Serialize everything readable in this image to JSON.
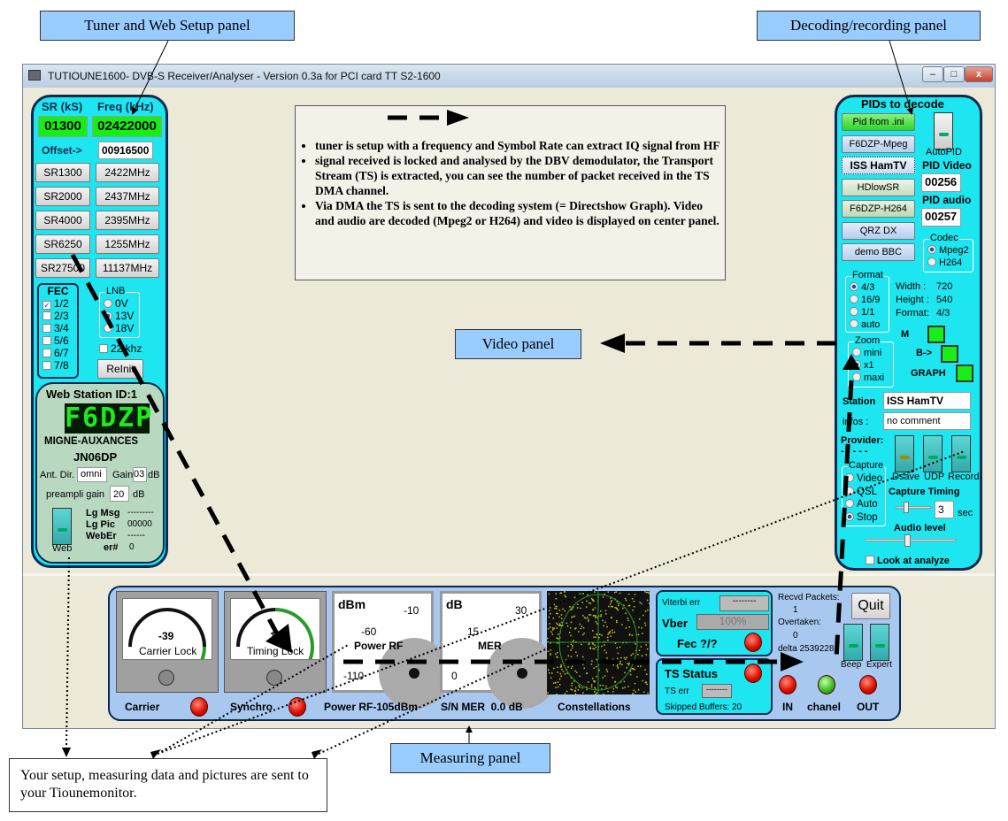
{
  "callouts": {
    "tuner": "Tuner and Web Setup panel",
    "decoding": "Decoding/recording panel",
    "video": "Video panel",
    "measuring": "Measuring panel",
    "bottom_note": "Your setup, measuring data and pictures are sent to your Tiounemonitor."
  },
  "window": {
    "title": "TUTIOUNE1600- DVB-S Receiver/Analyser - Version 0.3a for PCI card TT S2-1600",
    "minimize": "–",
    "maximize": "□",
    "close": "x"
  },
  "info_box": {
    "bullets": [
      "tuner is setup with a frequency and Symbol Rate can extract IQ signal from HF",
      "signal received is locked and analysed by the DBV demodulator, the Transport Stream (TS) is extracted, you can see the number of packet received in the TS DMA channel.",
      "Via DMA the TS is sent to the decoding system (= Directshow Graph). Video and audio are decoded (Mpeg2 or H264) and video is displayed on center panel."
    ]
  },
  "tuner": {
    "sr_label": "SR (kS)",
    "freq_label": "Freq (kHz)",
    "sr_value": "01300",
    "freq_value": "02422000",
    "offset_label": "Offset->",
    "offset_value": "00916500",
    "sr_buttons": [
      "SR1300",
      "SR2000",
      "SR4000",
      "SR6250",
      "SR27500"
    ],
    "freq_buttons": [
      "2422MHz",
      "2437MHz",
      "2395MHz",
      "1255MHz",
      "11137MHz"
    ],
    "fec_label": "FEC",
    "fec": [
      {
        "label": "1/2",
        "checked": true
      },
      {
        "label": "2/3",
        "checked": false
      },
      {
        "label": "3/4",
        "checked": false
      },
      {
        "label": "5/6",
        "checked": false
      },
      {
        "label": "6/7",
        "checked": false
      },
      {
        "label": "7/8",
        "checked": false
      }
    ],
    "lnb_label": "LNB",
    "lnb": [
      {
        "label": "0V",
        "selected": false
      },
      {
        "label": "13V",
        "selected": true
      },
      {
        "label": "18V",
        "selected": false
      }
    ],
    "khz22": "22 khz",
    "reinit": "ReInit"
  },
  "web": {
    "title": "Web Station ID:1",
    "callsign": "F6DZP",
    "location": "MIGNE-AUXANCES",
    "locator": "JN06DP",
    "ant_label": "Ant. Dir.",
    "ant_value": "omni",
    "gain_label": "Gain",
    "gain_value": "03",
    "gain_unit": "dB",
    "preampli_label": "preampli gain",
    "preampli_value": "20",
    "preampli_unit": "dB",
    "switch_label": "Web",
    "stats": [
      {
        "k": "Lg Msg",
        "v": "---------"
      },
      {
        "k": "Lg Pic",
        "v": "00000"
      },
      {
        "k": "WebEr",
        "v": "------"
      },
      {
        "k": "er#",
        "v": "0"
      }
    ]
  },
  "decode": {
    "title": "PIDs to decode",
    "presets": [
      "Pid from .ini",
      "F6DZP-Mpeg",
      "ISS HamTV",
      "HDlowSR",
      "F6DZP-H264",
      "QRZ DX",
      "demo BBC"
    ],
    "autopid": "AutoPID",
    "pid_video_label": "PID Video",
    "pid_video": "00256",
    "pid_audio_label": "PID audio",
    "pid_audio": "00257",
    "codec_label": "Codec",
    "codec": [
      {
        "label": "Mpeg2",
        "selected": true
      },
      {
        "label": "H264",
        "selected": false
      }
    ],
    "format_label": "Format",
    "format": [
      {
        "label": "4/3",
        "selected": true
      },
      {
        "label": "16/9",
        "selected": false
      },
      {
        "label": "1/1",
        "selected": false
      },
      {
        "label": "auto",
        "selected": false
      }
    ],
    "info": [
      {
        "k": "Width :",
        "v": "720"
      },
      {
        "k": "Height :",
        "v": "540"
      },
      {
        "k": "Format:",
        "v": "4/3"
      }
    ],
    "zoom_label": "Zoom",
    "zoom": [
      {
        "label": "mini",
        "selected": false
      },
      {
        "label": "x1",
        "selected": true
      },
      {
        "label": "maxi",
        "selected": false
      }
    ],
    "m_label": "M",
    "b_label": "B->",
    "graph_label": "GRAPH",
    "station_label": "Station",
    "station_value": "ISS HamTV",
    "infos_label": "infos :",
    "infos_value": "no comment",
    "provider_label": "Provider:",
    "provider_value": "- - - - -",
    "switches": [
      "Dsave",
      "UDP",
      "Record"
    ],
    "capture_label": "Capture",
    "capture": [
      {
        "label": "Video",
        "selected": false
      },
      {
        "label": "QSL",
        "selected": false
      },
      {
        "label": "Auto",
        "selected": false
      },
      {
        "label": "Stop",
        "selected": true
      }
    ],
    "capture_timing_label": "Capture Timing",
    "capture_timing_value": "3",
    "capture_timing_unit": "sec",
    "audio_level_label": "Audio level",
    "audio_level": 0.45,
    "look_label": "Look at analyze"
  },
  "measure": {
    "carrier_meter": {
      "value": "-39",
      "label": "Carrier Lock"
    },
    "timing_meter": {
      "value": "12",
      "label": "Timing Lock"
    },
    "power_meter": {
      "unit": "dBm",
      "t1": "-10",
      "t2": "-60",
      "t3": "-110",
      "label": "Power RF"
    },
    "mer_meter": {
      "unit": "dB",
      "t1": "30",
      "t2": "15",
      "t3": "0",
      "label": "MER"
    },
    "carrier_label": "Carrier",
    "synchro_label": "Synchro",
    "power_text": "Power RF-105dBm",
    "mer_text": "S/N MER  0.0 dB",
    "constellation_label": "Constellations",
    "viterbi_label": "Viterbi err",
    "viterbi_value": "--------",
    "vber_label": "Vber",
    "vber_value": "100%",
    "fec_label": "Fec  ?/?",
    "ts_status": "TS Status",
    "ts_err_label": "TS err",
    "ts_err_value": "--------",
    "skipped": "Skipped Buffers: 20",
    "recvd_label": "Recvd Packets:",
    "recvd_value": "1",
    "overtaken_label": "Overtaken:",
    "overtaken_value": "0",
    "delta": "delta 2539228",
    "quit": "Quit",
    "beep": "Beep",
    "expert": "Expert",
    "in_label": "IN",
    "chanel_label": "chanel",
    "out_label": "OUT"
  },
  "colors": {
    "panel": "#1ee6f0",
    "web_panel": "#b8d8c0",
    "measure_panel": "#a8c8f0",
    "callout": "#99ccff",
    "lcd_green": "#14f014"
  }
}
